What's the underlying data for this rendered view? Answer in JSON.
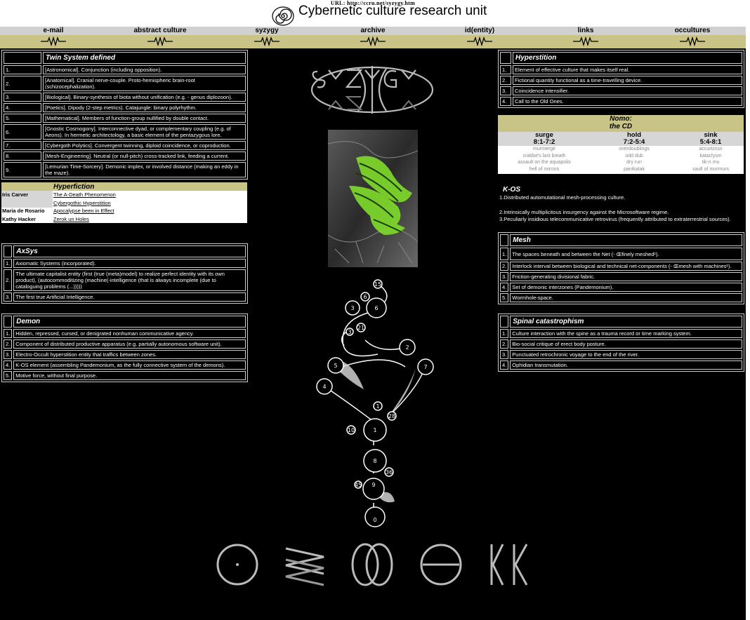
{
  "header": {
    "url": "URL: http://ccru.net/syzygy.htm",
    "title": "Cybernetic culture research unit"
  },
  "nav": {
    "items": [
      "e-mail",
      "abstract culture",
      "syzygy",
      "archive",
      "id(entity)",
      "links",
      "occultures"
    ]
  },
  "twin": {
    "title": "Twin System defined",
    "rows": [
      {
        "n": "1.",
        "t": "[Astronomical]. Conjunction (including opposition)."
      },
      {
        "n": "2.",
        "t": "[Anatomical]. Cranial nerve-couple. Proto-hemispheric brain-root (schizocephalization)."
      },
      {
        "n": "3.",
        "t": "[Biological]. Binary-synthesis of biota without unification (e.g. - genus diplozoon)."
      },
      {
        "n": "4.",
        "t": "[Poetics]. Dipody (2-step metrics). Catajungle: binary polyrhythm."
      },
      {
        "n": "5.",
        "t": "[Mathematical]. Members of function-group nullified by double contact."
      },
      {
        "n": "6.",
        "t": "[Gnostic Cosmogony]. Interconnective dyad, or complementary coupling (e.g. of Aeons). In hermetic architectology, a basic element of the pentazygous lore."
      },
      {
        "n": "7.",
        "t": "[Cybergoth Polytics]. Convergent twinning, diploid coincidence, or coproduction."
      },
      {
        "n": "8.",
        "t": "[Mesh-Engineering]. Neutral (or null-pitch) cross-tracked link, feeding a current."
      },
      {
        "n": "9.",
        "t": "[Lemurian Time-Sorcery]. Demonic implex, or involved distance (making an eddy in the maze)."
      }
    ]
  },
  "hyperfiction": {
    "title": "Hyperfiction",
    "rows": [
      {
        "author": "Iris Carver",
        "title": "The A-Death Phenomenon"
      },
      {
        "author": "",
        "title": "Cybergothic Hyperstition"
      },
      {
        "author": "Maria de Rosario",
        "title": "Apocalypse been in Effect"
      },
      {
        "author": "Kathy Hacker",
        "title": "Zerok un Holes"
      }
    ]
  },
  "axsys": {
    "title": "AxSys",
    "rows": [
      {
        "n": "1.",
        "t": "Axiomatic Systems (incorporated)."
      },
      {
        "n": "2.",
        "t": "The ultimate capitalist entity (first (true (meta)model) to realize perfect identity with its own product), (autocommoditizing (machine(-intelligence (that is always incomplete (due to cataloguing problems (...)))))"
      },
      {
        "n": "3.",
        "t": "The first true Artificial Intelligence."
      }
    ]
  },
  "demon": {
    "title": "Demon",
    "rows": [
      {
        "n": "1.",
        "t": "Hidden, repressed, cursed, or denigrated nonhuman communicative agency."
      },
      {
        "n": "2.",
        "t": "Component of distributed productive apparatus (e.g. partially autonomous software unit)."
      },
      {
        "n": "3.",
        "t": "Electro-Occult hyperstition entity that traffics between zones."
      },
      {
        "n": "4.",
        "t": "K-OS element (assembling Pandemonium, as the fully connective system of the demons)."
      },
      {
        "n": "5.",
        "t": "Motive force, without final purpose."
      }
    ]
  },
  "hyperstition": {
    "title": "Hyperstition",
    "rows": [
      {
        "n": "1.",
        "t": "Element of effective culture that makes itself real."
      },
      {
        "n": "2.",
        "t": "Fictional quantity functional as a time-travelling device."
      },
      {
        "n": "3.",
        "t": "Coincidence intensifier."
      },
      {
        "n": "4.",
        "t": "Call to the Old Ones."
      }
    ]
  },
  "nomo": {
    "title1": "Nomo:",
    "title2": "the CD",
    "columns": [
      {
        "name": "surge",
        "ratio": "8:1-7:2",
        "tracks": [
          "murmerge",
          "crabbe's last breath",
          "assault on the aquapolis",
          "hell of mirrors"
        ]
      },
      {
        "name": "hold",
        "ratio": "7:2-5:4",
        "tracks": [
          "overdoublings",
          "odd dub",
          "dry run",
          "panikatak"
        ]
      },
      {
        "name": "sink",
        "ratio": "5:4-8:1",
        "tracks": [
          "accurtzsss",
          "kataclysm",
          "tik-n mu",
          "vault of murmurs"
        ]
      }
    ]
  },
  "kos": {
    "title": "K-OS",
    "items": [
      "1.Distributed automutational mesh-processing culture.",
      "2.Intrinsically multiplicitous insurgency against the Microsoftware regime.",
      "3.Peculiarly insidious telecommunicative retrovirus (frequently attributed to extraterrestrial sources)."
    ]
  },
  "mesh": {
    "title": "Mesh",
    "rows": [
      {
        "n": "1.",
        "t": "The spaces beneath and between the Net (- Œfinely meshed¹)."
      },
      {
        "n": "2.",
        "t": "Interlock interval between biological and technical net-components (- Œmesh with machines¹)."
      },
      {
        "n": "3.",
        "t": "Friction-generating divisional fabric."
      },
      {
        "n": "4.",
        "t": "Set of demonic interzones (Pandemonium)."
      },
      {
        "n": "5.",
        "t": "Wormhole-space."
      }
    ]
  },
  "spinal": {
    "title": "Spinal catastrophism",
    "rows": [
      {
        "n": "1.",
        "t": "Culture interaction with the spine as a trauma record or time marking system."
      },
      {
        "n": "2.",
        "t": "Bio-social critique of erect body posture."
      },
      {
        "n": "3.",
        "t": "Punctuated retrochronic voyage to the end of the river."
      },
      {
        "n": "4.",
        "t": "Ophidian transmutation."
      }
    ]
  },
  "diagram": {
    "nodes": [
      "1",
      "2",
      "3",
      "4",
      "5",
      "6",
      "7",
      "8",
      "9",
      "0",
      "15",
      "21",
      "28",
      "36",
      "45",
      "10",
      "6",
      "3",
      "1"
    ]
  },
  "icons": {
    "logo": "spiral-logo-icon",
    "zigzag": "zigzag-resistor-icon",
    "glyphs": [
      "circle-dot-glyph-icon",
      "zigzag-lines-glyph-icon",
      "double-ring-glyph-icon",
      "theta-glyph-icon",
      "kk-glyph-icon"
    ]
  }
}
